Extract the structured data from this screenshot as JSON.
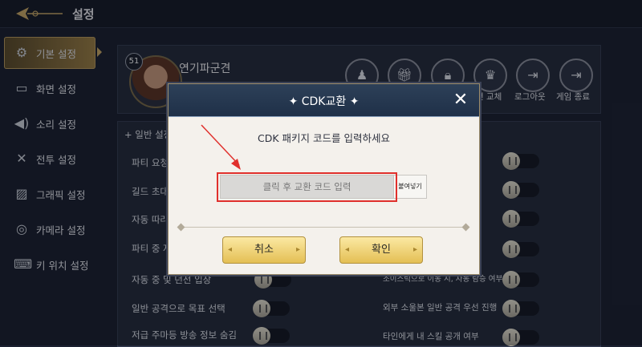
{
  "header": {
    "title": "설정"
  },
  "sidebar": {
    "items": [
      {
        "label": "기본 설정",
        "icon": "gear-icon",
        "active": true
      },
      {
        "label": "화면 설정",
        "icon": "monitor-icon"
      },
      {
        "label": "소리 설정",
        "icon": "speaker-icon"
      },
      {
        "label": "전투 설정",
        "icon": "swords-icon"
      },
      {
        "label": "그래픽 설정",
        "icon": "image-icon"
      },
      {
        "label": "카메라 설정",
        "icon": "camera-icon"
      },
      {
        "label": "키 위치 설정",
        "icon": "keyboard-icon"
      }
    ]
  },
  "profile": {
    "level": "51",
    "name": "연기파군견",
    "actions": [
      {
        "label": "",
        "icon": "character-icon"
      },
      {
        "label": "",
        "icon": "gift-icon"
      },
      {
        "label": "",
        "icon": "lock-icon"
      },
      {
        "label": "면 교체",
        "icon": "crest-icon"
      },
      {
        "label": "로그아웃",
        "icon": "logout-icon"
      },
      {
        "label": "게임 종료",
        "icon": "exit-icon"
      }
    ]
  },
  "settings": {
    "section": "+ 일반 설정",
    "left_rows": [
      "파티 요청",
      "길드 초대",
      "자동 따라",
      "파티 중 자",
      "자동 중 및 던전 입장",
      "일반 공격으로 목표 선택",
      "저급 주마등 방송 정보 숨김"
    ],
    "right_rows": [
      "조이스틱으로 이동 시, 자동 탐승 여부",
      "외부 소울본 일반 공격 우선 진행",
      "타인에게 내 스킬 공개 여부"
    ]
  },
  "dialog": {
    "title": "CDK교환",
    "prompt": "CDK 패키지 코드를 입력하세요",
    "input_placeholder": "클릭 후 교환 코드 입력",
    "paste_label": "붙여넣기",
    "cancel_label": "취소",
    "confirm_label": "확인"
  },
  "colors": {
    "accent": "#e0302c",
    "button": "#f0d27a",
    "header": "#2d4058"
  }
}
